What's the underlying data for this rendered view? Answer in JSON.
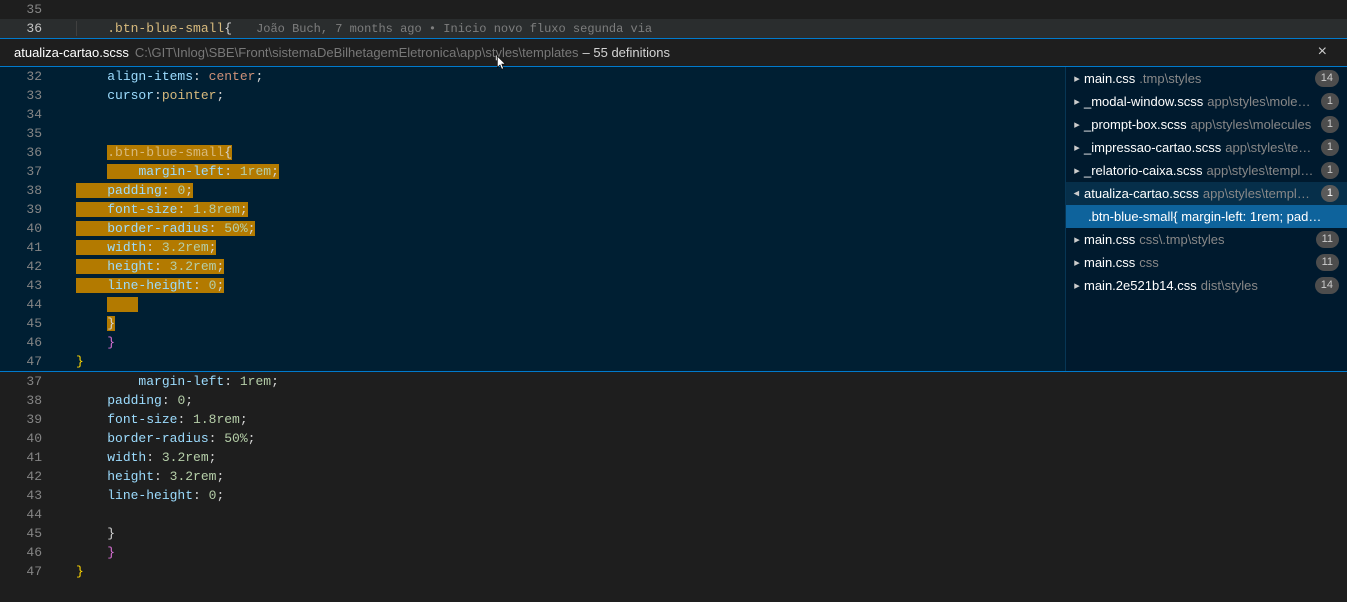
{
  "top": {
    "lines": [
      {
        "num": "35",
        "content": ""
      },
      {
        "num": "36",
        "selector": ".btn-blue-small",
        "brace": "{",
        "codelens": "João Buch, 7 months ago • Inicio novo fluxo segunda via"
      }
    ]
  },
  "peek_header": {
    "filename": "atualiza-cartao.scss",
    "path": "C:\\GIT\\Inlog\\SBE\\Front\\sistemaDeBilhetagemEletronica\\app\\styles\\templates",
    "count": "– 55 definitions"
  },
  "peek_code": [
    {
      "num": "32",
      "prop": "align-items",
      "val_keyword": "center",
      "end": ";"
    },
    {
      "num": "33",
      "prop": "cursor",
      "pseudo": ":pointer",
      "end": ";"
    },
    {
      "num": "34",
      "blank": true
    },
    {
      "num": "35",
      "blank": true
    },
    {
      "num": "36",
      "selector": ".btn-blue-small",
      "brace": "{",
      "highlighted": true
    },
    {
      "num": "37",
      "prop": "margin-left",
      "val_num": "1rem",
      "end": ";",
      "highlighted": true,
      "indent_extra": true
    },
    {
      "num": "38",
      "prop": "padding",
      "val_num": "0",
      "end": ";",
      "highlighted": true
    },
    {
      "num": "39",
      "prop": "font-size",
      "val_num": "1.8rem",
      "end": ";",
      "highlighted": true
    },
    {
      "num": "40",
      "prop": "border-radius",
      "val_num": "50%",
      "end": ";",
      "highlighted": true
    },
    {
      "num": "41",
      "prop": "width",
      "val_num": "3.2rem",
      "end": ";",
      "highlighted": true
    },
    {
      "num": "42",
      "prop": "height",
      "val_num": "3.2rem",
      "end": ";",
      "highlighted": true
    },
    {
      "num": "43",
      "prop": "line-height",
      "val_num": "0",
      "end": ";",
      "highlighted": true
    },
    {
      "num": "44",
      "blank": true,
      "highlighted_partial": true
    },
    {
      "num": "45",
      "close_brace": "}",
      "highlighted_close": true
    },
    {
      "num": "46",
      "outer_close": "}"
    },
    {
      "num": "47",
      "outer_close2": "}"
    }
  ],
  "peek_side": [
    {
      "name": "main.css",
      "path": ".tmp\\styles",
      "badge": "14",
      "chev": true
    },
    {
      "name": "_modal-window.scss",
      "path": "app\\styles\\mole…",
      "badge": "1",
      "chev": true
    },
    {
      "name": "_prompt-box.scss",
      "path": "app\\styles\\molecules",
      "badge": "1",
      "chev": true
    },
    {
      "name": "_impressao-cartao.scss",
      "path": "app\\styles\\te…",
      "badge": "1",
      "chev": true
    },
    {
      "name": "_relatorio-caixa.scss",
      "path": "app\\styles\\templ…",
      "badge": "1",
      "chev": true
    },
    {
      "name": "atualiza-cartao.scss",
      "path": "app\\styles\\templ…",
      "badge": "1",
      "chev": true,
      "expanded": true,
      "selected": true
    },
    {
      "sub": true,
      "text": ".btn-blue-small{ margin-left: 1rem; pad…",
      "sub_selected": true
    },
    {
      "name": "main.css",
      "path": "css\\.tmp\\styles",
      "badge": "11",
      "chev": true
    },
    {
      "name": "main.css",
      "path": "css",
      "badge": "11",
      "chev": true
    },
    {
      "name": "main.2e521b14.css",
      "path": "dist\\styles",
      "badge": "14",
      "chev": true
    }
  ],
  "bottom": [
    {
      "num": "37",
      "prop": "margin-left",
      "val_num": "1rem",
      "end": ";",
      "indent_extra": true
    },
    {
      "num": "38",
      "prop": "padding",
      "val_num": "0",
      "end": ";"
    },
    {
      "num": "39",
      "prop": "font-size",
      "val_num": "1.8rem",
      "end": ";"
    },
    {
      "num": "40",
      "prop": "border-radius",
      "val_num": "50%",
      "end": ";"
    },
    {
      "num": "41",
      "prop": "width",
      "val_num": "3.2rem",
      "end": ";"
    },
    {
      "num": "42",
      "prop": "height",
      "val_num": "3.2rem",
      "end": ";"
    },
    {
      "num": "43",
      "prop": "line-height",
      "val_num": "0",
      "end": ";"
    },
    {
      "num": "44",
      "blank": true
    },
    {
      "num": "45",
      "close_brace": "}"
    },
    {
      "num": "46",
      "outer_close": "}"
    },
    {
      "num": "47",
      "outer_close2": "}"
    }
  ]
}
